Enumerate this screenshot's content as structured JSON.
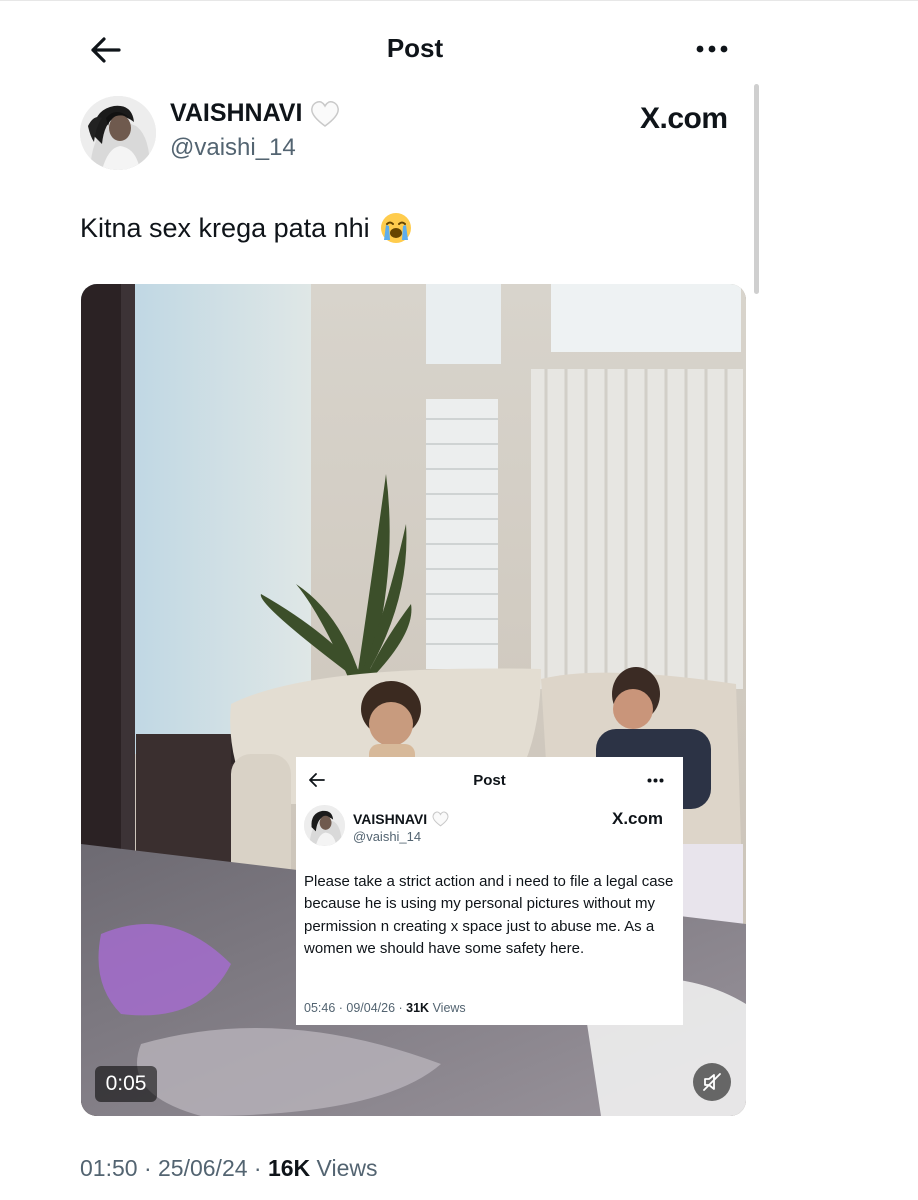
{
  "header": {
    "title": "Post"
  },
  "author": {
    "display_name": "VAISHNAVI",
    "handle": "@vaishi_14",
    "badge_icon": "white-heart-icon"
  },
  "watermark": "X.com",
  "post": {
    "text": "Kitna sex krega pata nhi",
    "emoji_icon": "loudly-crying-face-icon",
    "timestamp": "01:50 · 25/06/24 · ",
    "views_count": "16K",
    "views_label": " Views"
  },
  "video": {
    "time": "0:05",
    "mute_icon": "muted-speaker-icon"
  },
  "embedded_post": {
    "title": "Post",
    "display_name": "VAISHNAVI",
    "handle": "@vaishi_14",
    "watermark": "X.com",
    "text": "Please take a strict action and i need to file a legal case because he is using my personal pictures without my permission n creating x space just to abuse me. As a women we should have some safety here.",
    "timestamp": "05:46 · 09/04/26 · ",
    "views_count": "31K",
    "views_label": " Views"
  },
  "colors": {
    "text_primary": "#0f1419",
    "text_secondary": "#536471",
    "background": "#ffffff"
  }
}
